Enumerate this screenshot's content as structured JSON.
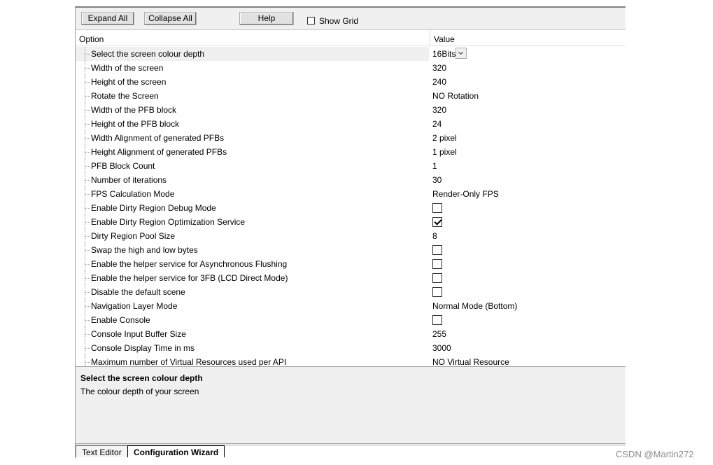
{
  "toolbar": {
    "expand_all": "Expand All",
    "collapse_all": "Collapse All",
    "help": "Help",
    "show_grid_label": "Show Grid",
    "show_grid_checked": false
  },
  "columns": {
    "option": "Option",
    "value": "Value"
  },
  "rows": [
    {
      "name": "Select the screen colour depth",
      "value": "16Bits",
      "kind": "dropdown",
      "selected": true
    },
    {
      "name": "Width of the screen",
      "value": "320",
      "kind": "text"
    },
    {
      "name": "Height of the screen",
      "value": "240",
      "kind": "text"
    },
    {
      "name": "Rotate the Screen",
      "value": "NO Rotation",
      "kind": "text"
    },
    {
      "name": "Width of the PFB block",
      "value": "320",
      "kind": "text"
    },
    {
      "name": "Height of the PFB block",
      "value": "24",
      "kind": "text"
    },
    {
      "name": "Width Alignment of generated PFBs",
      "value": "2 pixel",
      "kind": "text"
    },
    {
      "name": "Height Alignment of generated PFBs",
      "value": "1 pixel",
      "kind": "text"
    },
    {
      "name": "PFB Block Count",
      "value": "1",
      "kind": "text"
    },
    {
      "name": "Number of iterations",
      "value": "30",
      "kind": "text"
    },
    {
      "name": "FPS Calculation Mode",
      "value": "Render-Only FPS",
      "kind": "text"
    },
    {
      "name": "Enable Dirty Region Debug Mode",
      "kind": "checkbox",
      "checked": false
    },
    {
      "name": "Enable Dirty Region Optimization Service",
      "kind": "checkbox",
      "checked": true
    },
    {
      "name": "Dirty Region Pool Size",
      "value": "8",
      "kind": "text"
    },
    {
      "name": "Swap the high and low bytes",
      "kind": "checkbox",
      "checked": false
    },
    {
      "name": "Enable the helper service for Asynchronous Flushing",
      "kind": "checkbox",
      "checked": false
    },
    {
      "name": "Enable the helper service for 3FB (LCD Direct Mode)",
      "kind": "checkbox",
      "checked": false
    },
    {
      "name": "Disable the default scene",
      "kind": "checkbox",
      "checked": false
    },
    {
      "name": "Navigation Layer Mode",
      "value": "Normal Mode (Bottom)",
      "kind": "text"
    },
    {
      "name": "Enable Console",
      "kind": "checkbox",
      "checked": false
    },
    {
      "name": "Console Input Buffer Size",
      "value": "255",
      "kind": "text"
    },
    {
      "name": "Console Display Time in ms",
      "value": "3000",
      "kind": "text"
    },
    {
      "name": "Maximum number of Virtual Resources used per API",
      "value": "NO Virtual Resource",
      "kind": "text"
    }
  ],
  "description": {
    "title": "Select the screen colour depth",
    "text": "The colour depth of your screen"
  },
  "tabs": [
    {
      "label": "Text Editor",
      "active": false
    },
    {
      "label": "Configuration Wizard",
      "active": true
    }
  ],
  "watermark": "CSDN @Martin272"
}
